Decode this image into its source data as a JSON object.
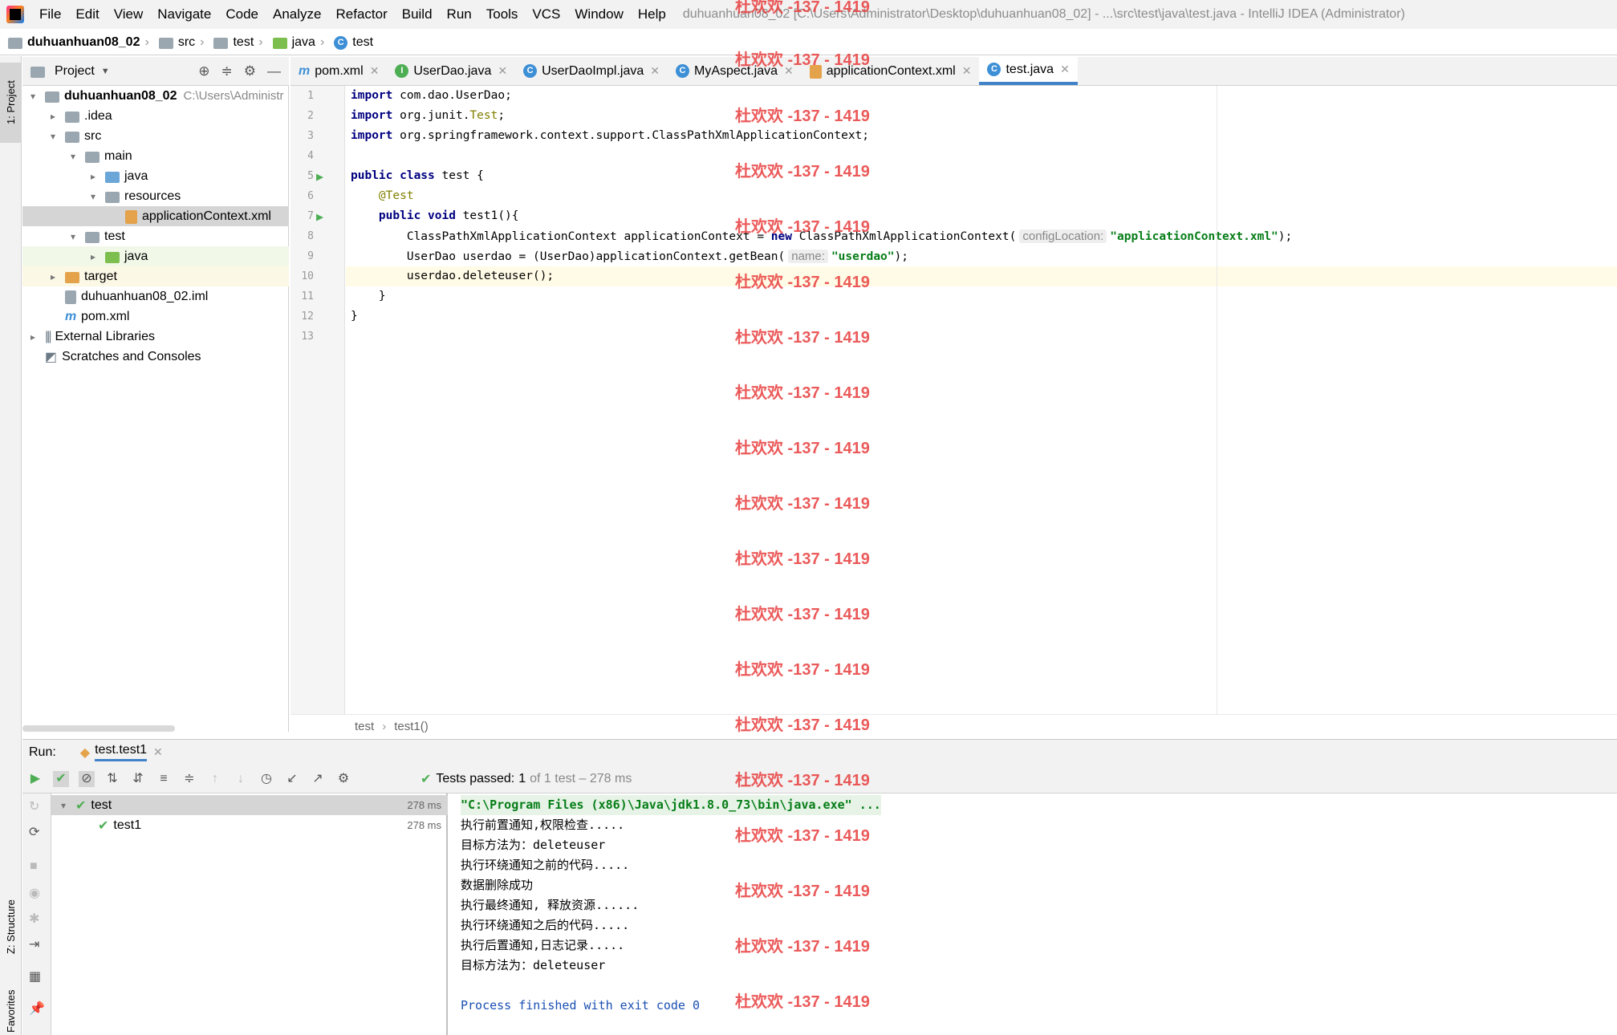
{
  "menu": {
    "items": [
      "File",
      "Edit",
      "View",
      "Navigate",
      "Code",
      "Analyze",
      "Refactor",
      "Build",
      "Run",
      "Tools",
      "VCS",
      "Window",
      "Help"
    ],
    "window_title": "duhuanhuan08_02 [C:\\Users\\Administrator\\Desktop\\duhuanhuan08_02] - ...\\src\\test\\java\\test.java - IntelliJ IDEA (Administrator)"
  },
  "breadcrumb": [
    "duhuanhuan08_02",
    "src",
    "test",
    "java",
    "test"
  ],
  "project": {
    "header": "Project",
    "tab_label": "1: Project",
    "tree": [
      {
        "label": "duhuanhuan08_02",
        "extra": "C:\\Users\\Administr",
        "depth": 0,
        "arrow": "▾",
        "icon": "module-folder"
      },
      {
        "label": ".idea",
        "depth": 1,
        "arrow": "▸",
        "icon": "folder"
      },
      {
        "label": "src",
        "depth": 1,
        "arrow": "▾",
        "icon": "folder"
      },
      {
        "label": "main",
        "depth": 2,
        "arrow": "▾",
        "icon": "folder"
      },
      {
        "label": "java",
        "depth": 3,
        "arrow": "▸",
        "icon": "source-folder"
      },
      {
        "label": "resources",
        "depth": 3,
        "arrow": "▾",
        "icon": "resources-folder"
      },
      {
        "label": "applicationContext.xml",
        "depth": 4,
        "arrow": "",
        "icon": "xml-file"
      },
      {
        "label": "test",
        "depth": 2,
        "arrow": "▾",
        "icon": "folder"
      },
      {
        "label": "java",
        "depth": 3,
        "arrow": "▸",
        "icon": "test-folder"
      },
      {
        "label": "target",
        "depth": 1,
        "arrow": "▸",
        "icon": "excluded-folder"
      },
      {
        "label": "duhuanhuan08_02.iml",
        "depth": 1,
        "arrow": "",
        "icon": "iml-file"
      },
      {
        "label": "pom.xml",
        "depth": 1,
        "arrow": "",
        "icon": "maven-file"
      },
      {
        "label": "External Libraries",
        "depth": 0,
        "arrow": "▸",
        "icon": "library"
      },
      {
        "label": "Scratches and Consoles",
        "depth": 0,
        "arrow": "",
        "icon": "scratches"
      }
    ]
  },
  "tabs": [
    "pom.xml",
    "UserDao.java",
    "UserDaoImpl.java",
    "MyAspect.java",
    "applicationContext.xml",
    "test.java"
  ],
  "editor": {
    "line_numbers": [
      "1",
      "2",
      "3",
      "4",
      "5",
      "6",
      "7",
      "8",
      "9",
      "10",
      "11",
      "12",
      "13"
    ],
    "hint_config": "configLocation:",
    "hint_name": "name:",
    "crumb": [
      "test",
      "test1()"
    ]
  },
  "run": {
    "label": "Run:",
    "config": "test.test1",
    "status_prefix": "Tests passed:",
    "status_count": "1",
    "status_suffix": "of 1 test – 278 ms",
    "tree": [
      {
        "label": "test",
        "time": "278 ms"
      },
      {
        "label": "test1",
        "time": "278 ms"
      }
    ],
    "console": [
      "\"C:\\Program Files (x86)\\Java\\jdk1.8.0_73\\bin\\java.exe\" ...",
      "执行前置通知,权限检查.....",
      "目标方法为：deleteuser",
      "执行环绕通知之前的代码.....",
      "数据删除成功",
      "执行最终通知, 释放资源......",
      "执行环绕通知之后的代码.....",
      "执行后置通知,日志记录.....",
      "目标方法为：deleteuser",
      "",
      "Process finished with exit code 0"
    ]
  },
  "side_tabs": {
    "structure": "Z: Structure",
    "favorites": "Favorites"
  },
  "watermark": "杜欢欢 -137 - 1419",
  "colors": {
    "keyword": "#000080",
    "string": "#067d17",
    "annotation": "#808000",
    "watermark": "#e83e3e"
  }
}
